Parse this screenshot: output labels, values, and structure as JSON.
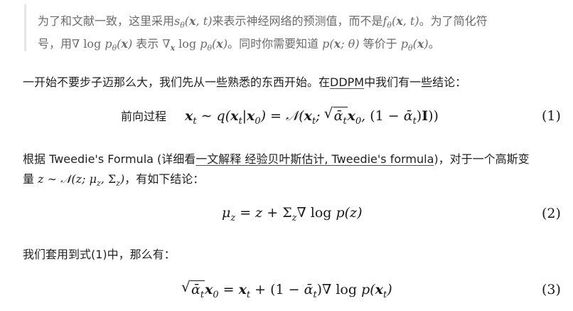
{
  "quote": {
    "line1_a": "为了和文献一致，这里采用",
    "line1_s": "sθ(x, t)",
    "line1_b": "来表示神经网络的预测值，而不是",
    "line1_f": "fθ(x, t)",
    "line1_c": "。为了简化符",
    "line2_a": "号，用",
    "line2_m1": "∇ log pθ(x)",
    "line2_b": " 表示 ",
    "line2_m2": "∇x log pθ(x)",
    "line2_c": "。同时你需要知道 ",
    "line2_m3": "p(x; θ)",
    "line2_d": " 等价于 ",
    "line2_m4": "pθ(x)",
    "line2_e": "。"
  },
  "para1": {
    "prefix": "一开始不要步子迈那么大，我们先从一些熟悉的东西开始。在",
    "link": "DDPM",
    "suffix": "中我们有一些结论："
  },
  "eq1": {
    "label": "前向过程",
    "number": "(1)"
  },
  "para2": {
    "prefix": "根据 Tweedie's Formula (详细看",
    "link": "一文解释 经验贝叶斯估计, Tweedie's formula",
    "suffix": ")，对于一个高斯变",
    "line2_a": "量 ",
    "line2_math": "z ∼ 𝒩(z; μz, Σz)",
    "line2_b": "，有如下结论："
  },
  "eq2": {
    "number": "(2)"
  },
  "para3": {
    "text": "我们套用到式(1)中，那么有："
  },
  "eq3": {
    "number": "(3)"
  }
}
